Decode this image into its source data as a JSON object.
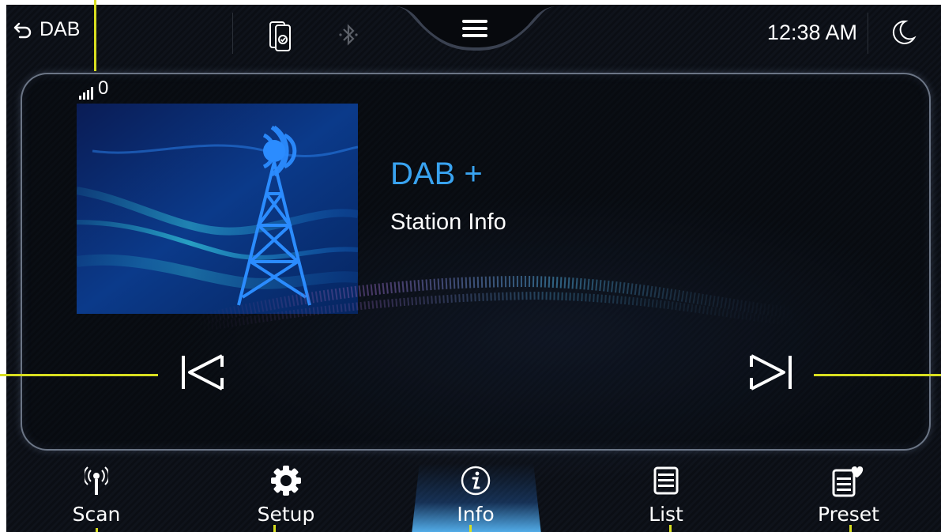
{
  "status_bar": {
    "back_label": "DAB",
    "time": "12:38 AM",
    "icons": [
      "back-arrow-icon",
      "phone-sync-icon",
      "bluetooth-icon",
      "menu-icon",
      "moon-icon"
    ]
  },
  "signal": {
    "value": "0",
    "icon": "signal-bars-icon"
  },
  "now_playing": {
    "title": "DAB +",
    "subtitle": "Station Info",
    "artwork": "radio-tower-artwork"
  },
  "controls": {
    "previous": "previous-track-icon",
    "next": "next-track-icon"
  },
  "bottom_nav": {
    "items": [
      {
        "label": "Scan",
        "icon": "scan-antenna-icon"
      },
      {
        "label": "Setup",
        "icon": "gear-icon"
      },
      {
        "label": "Info",
        "icon": "info-icon",
        "active": true
      },
      {
        "label": "List",
        "icon": "list-icon"
      },
      {
        "label": "Preset",
        "icon": "preset-heart-icon"
      }
    ]
  },
  "colors": {
    "accent": "#39a3f0",
    "callout": "#d8de20",
    "background": "#0b0e14"
  }
}
